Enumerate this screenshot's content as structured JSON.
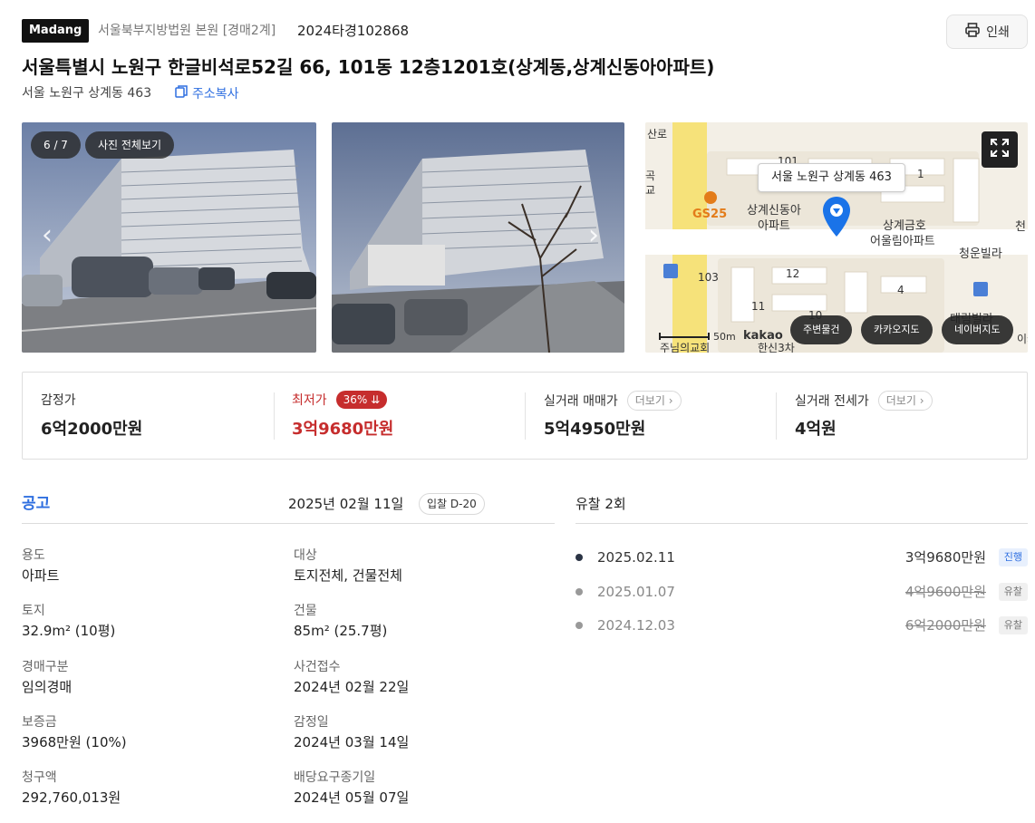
{
  "header": {
    "logo": "Madang",
    "court": "서울북부지방법원 본원 [경매2계]",
    "case_number": "2024타경102868",
    "print_label": "인쇄",
    "title": "서울특별시 노원구 한글비석로52길 66, 101동 12층1201호(상계동,상계신동아아파트)",
    "lot_address": "서울 노원구 상계동 463",
    "copy_label": "주소복사"
  },
  "gallery": {
    "counter": "6 / 7",
    "view_all": "사진 전체보기"
  },
  "map": {
    "callout": "서울 노원구 상계동 463",
    "labels": {
      "road": "산로",
      "gs25": "GS25",
      "apt1_line1": "상계신동아",
      "apt1_line2": "아파트",
      "apt2_line1": "상계금호",
      "apt2_line2": "어울림아파트",
      "villa": "청운빌라",
      "villa2": "태림빌라",
      "b101": "101",
      "b1": "1",
      "b103": "103",
      "b12": "12",
      "b11": "11",
      "b4": "4",
      "b10": "10",
      "church": "주님의교회",
      "hansin": "한신3차",
      "scale": "50m",
      "kakao": "kakao",
      "left_edge1": "곡",
      "left_edge2": "교",
      "right_edge1": "천",
      "right_edge2": "이케"
    },
    "buttons": {
      "nearby": "주변물건",
      "kakao_map": "카카오지도",
      "naver_map": "네이버지도"
    }
  },
  "prices": {
    "appraisal": {
      "label": "감정가",
      "value": "6억2000만원"
    },
    "minimum": {
      "label": "최저가",
      "badge": "36%",
      "value": "3억9680만원"
    },
    "trade": {
      "label": "실거래 매매가",
      "more": "더보기",
      "value": "5억4950만원"
    },
    "jeonse": {
      "label": "실거래 전세가",
      "more": "더보기",
      "value": "4억원"
    }
  },
  "notice": {
    "title": "공고",
    "date": "2025년 02월 11일",
    "dday": "입찰 D-20",
    "fields": [
      {
        "label": "용도",
        "value": "아파트"
      },
      {
        "label": "대상",
        "value": "토지전체, 건물전체"
      },
      {
        "label": "토지",
        "value": "32.9m² (10평)"
      },
      {
        "label": "건물",
        "value": "85m² (25.7평)"
      },
      {
        "label": "경매구분",
        "value": "임의경매"
      },
      {
        "label": "사건접수",
        "value": "2024년 02월 22일"
      },
      {
        "label": "보증금",
        "value": "3968만원 (10%)"
      },
      {
        "label": "감정일",
        "value": "2024년 03월 14일"
      },
      {
        "label": "청구액",
        "value": "292,760,013원"
      },
      {
        "label": "배당요구종기일",
        "value": "2024년 05월 07일"
      }
    ]
  },
  "history": {
    "title": "유찰 2회",
    "rows": [
      {
        "date": "2025.02.11",
        "price": "3억9680만원",
        "status": "진행"
      },
      {
        "date": "2025.01.07",
        "price": "4억9600만원",
        "status": "유찰"
      },
      {
        "date": "2024.12.03",
        "price": "6억2000만원",
        "status": "유찰"
      }
    ]
  },
  "colors": {
    "accent_blue": "#2f6fe0",
    "minimum_red": "#c62d2d",
    "map_pin": "#1a73e8"
  }
}
